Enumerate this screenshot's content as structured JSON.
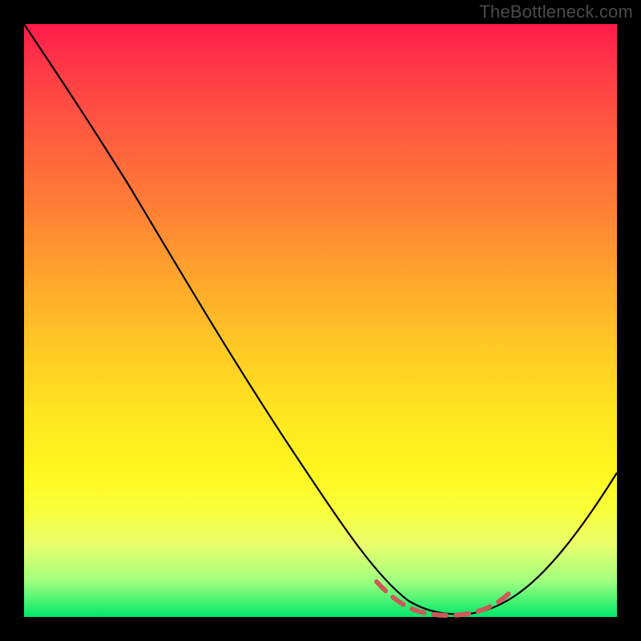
{
  "attribution": "TheBottleneck.com",
  "chart_data": {
    "type": "line",
    "title": "",
    "xlabel": "",
    "ylabel": "",
    "xlim": [
      0,
      100
    ],
    "ylim": [
      0,
      100
    ],
    "grid": false,
    "series": [
      {
        "name": "bottleneck-curve",
        "x": [
          0,
          10,
          20,
          30,
          40,
          50,
          58,
          64,
          70,
          76,
          80,
          86,
          92,
          100
        ],
        "y": [
          100,
          86,
          71,
          56,
          41,
          26,
          13,
          6,
          2,
          1,
          2,
          8,
          18,
          36
        ]
      }
    ],
    "highlight_range": {
      "x_start": 58,
      "x_end": 80,
      "y": 2
    },
    "gradient_stops": [
      {
        "pct": 0,
        "color": "#ff1a4b"
      },
      {
        "pct": 50,
        "color": "#ffd023"
      },
      {
        "pct": 85,
        "color": "#fdff3a"
      },
      {
        "pct": 100,
        "color": "#00e86a"
      }
    ],
    "colors": {
      "curve": "#000000",
      "highlight": "#cc5a5a",
      "frame": "#000000"
    }
  }
}
